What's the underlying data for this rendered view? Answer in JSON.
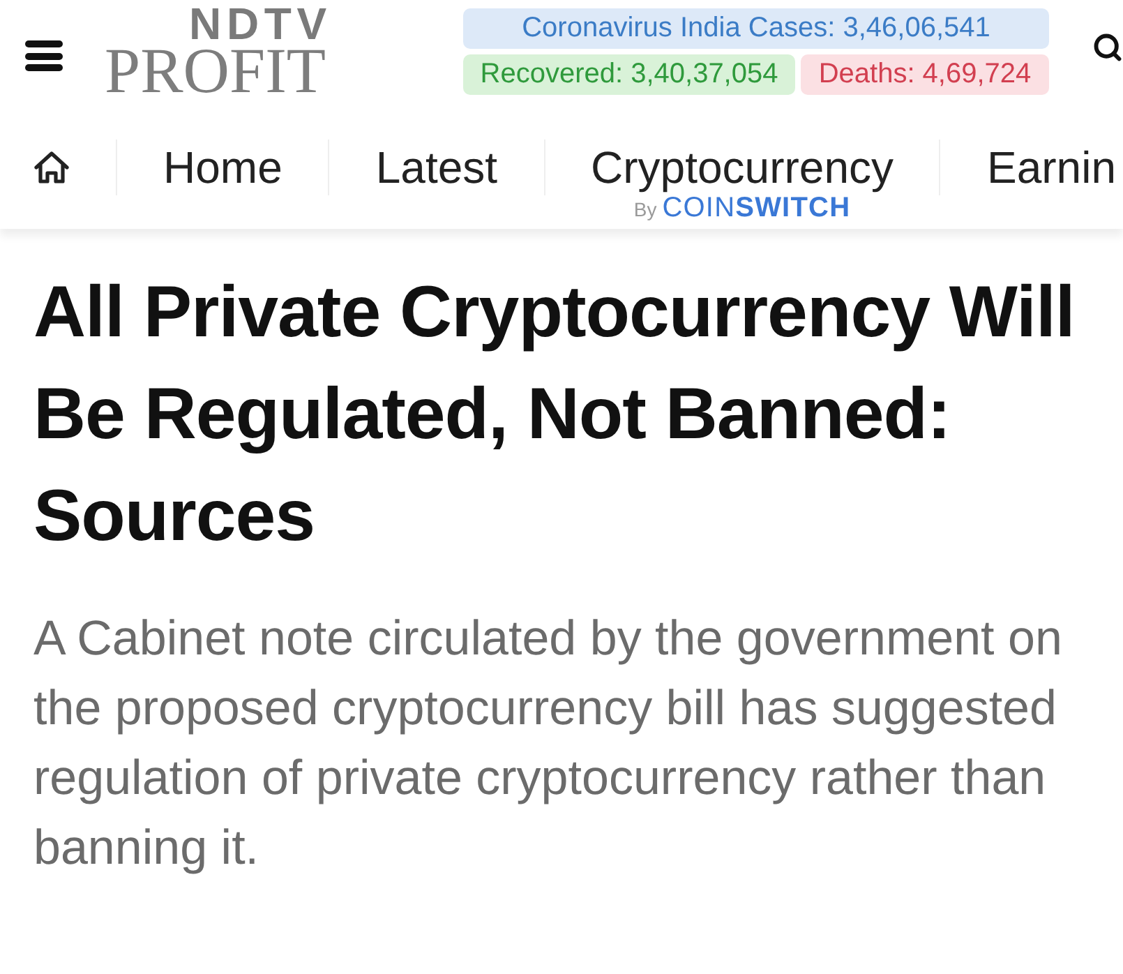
{
  "header": {
    "logo": {
      "top": "NDTV",
      "bottom": "PROFIT"
    },
    "covid": {
      "cases": "Coronavirus India Cases: 3,46,06,541",
      "recovered": "Recovered: 3,40,37,054",
      "deaths": "Deaths: 4,69,724"
    }
  },
  "nav": {
    "items": [
      {
        "label": "Home"
      },
      {
        "label": "Latest"
      },
      {
        "label": "Cryptocurrency",
        "sponsor": {
          "prefix": "By",
          "brand": "COIN**SWITCH**"
        }
      },
      {
        "label": "Earnin"
      }
    ]
  },
  "article": {
    "headline": "All Private Cryptocurrency Will Be Regulated, Not Banned: Sources",
    "summary": "A Cabinet note circulated by the government on the proposed cryptocurrency bill has suggested regulation of private cryptocurrency rather than banning it."
  }
}
